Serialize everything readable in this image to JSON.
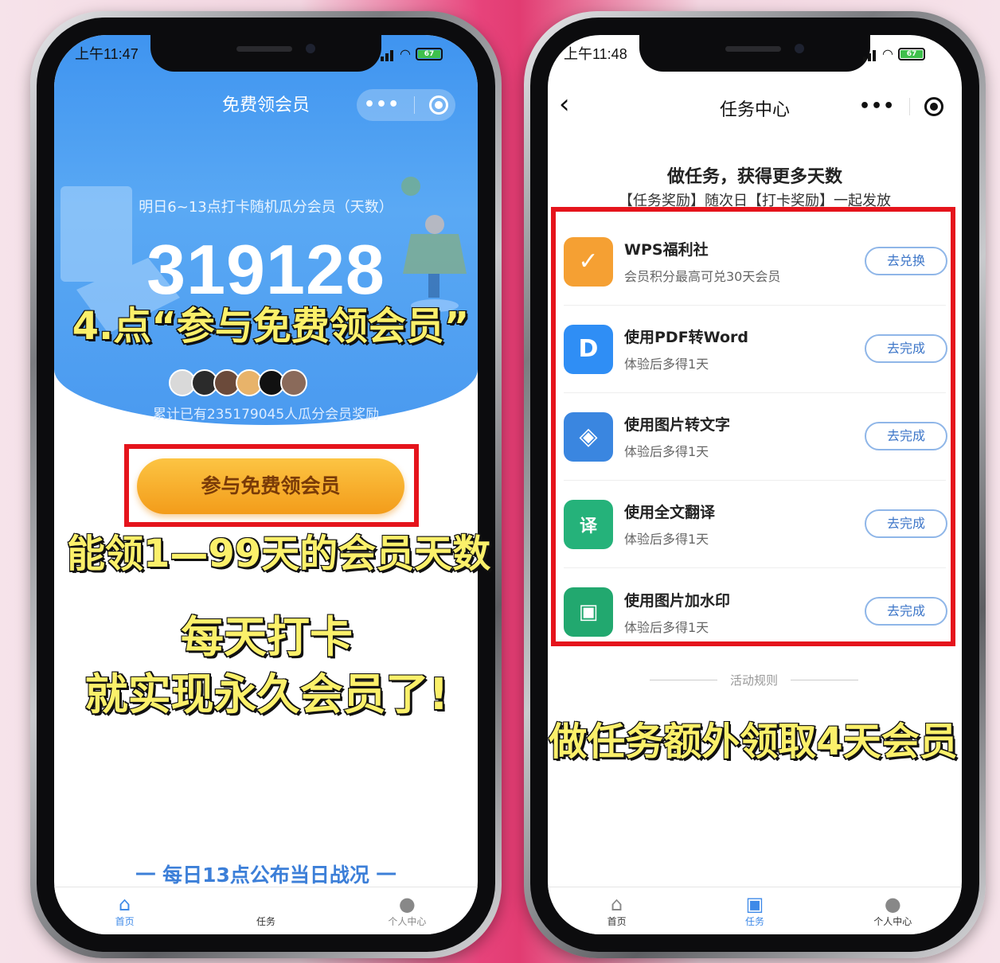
{
  "left": {
    "status_time": "上午11:47",
    "battery": "67",
    "nav_title": "免费领会员",
    "notice": "明日6~13点打卡随机瓜分会员（天数）",
    "big_number": "319128",
    "participants_text": "累计已有235179045人瓜分会员奖励",
    "cta_label": "参与免费领会员",
    "footer_text": "一 每日13点公布当日战况 一",
    "tabs": [
      {
        "label": "首页",
        "icon": "home-icon"
      },
      {
        "label": "任务",
        "icon": "task-icon"
      },
      {
        "label": "个人中心",
        "icon": "user-icon"
      }
    ],
    "captions": {
      "step": "4.点“参与免费领会员”",
      "line1": "能领1—99天的会员天数",
      "line2": "每天打卡",
      "line3": "就实现永久会员了!"
    }
  },
  "right": {
    "status_time": "上午11:48",
    "battery": "67",
    "nav_title": "任务中心",
    "headline": "做任务，获得更多天数",
    "subline": "【任务奖励】随次日【打卡奖励】一起发放",
    "tasks": [
      {
        "title": "WPS福利社",
        "subtitle": "会员积分最高可兑30天会员",
        "button": "去兑换",
        "icon": "gift-icon",
        "color": "#f5a033"
      },
      {
        "title": "使用PDF转Word",
        "subtitle": "体验后多得1天",
        "button": "去完成",
        "icon": "pdf-word-icon",
        "color": "#2f8ef5"
      },
      {
        "title": "使用图片转文字",
        "subtitle": "体验后多得1天",
        "button": "去完成",
        "icon": "image-text-icon",
        "color": "#3a86e0"
      },
      {
        "title": "使用全文翻译",
        "subtitle": "体验后多得1天",
        "button": "去完成",
        "icon": "translate-icon",
        "color": "#25b27a"
      },
      {
        "title": "使用图片加水印",
        "subtitle": "体验后多得1天",
        "button": "去完成",
        "icon": "watermark-icon",
        "color": "#22a86f"
      }
    ],
    "rules_label": "活动规则",
    "tabs": [
      {
        "label": "首页",
        "icon": "home-icon"
      },
      {
        "label": "任务",
        "icon": "calendar-check-icon"
      },
      {
        "label": "个人中心",
        "icon": "user-icon"
      }
    ],
    "caption": "做任务额外领取4天会员"
  },
  "colors": {
    "primary_blue": "#3f94f0",
    "cta_orange": "#f7b02b",
    "highlight_red": "#e5141c",
    "caption_yellow": "#fbf06a"
  }
}
